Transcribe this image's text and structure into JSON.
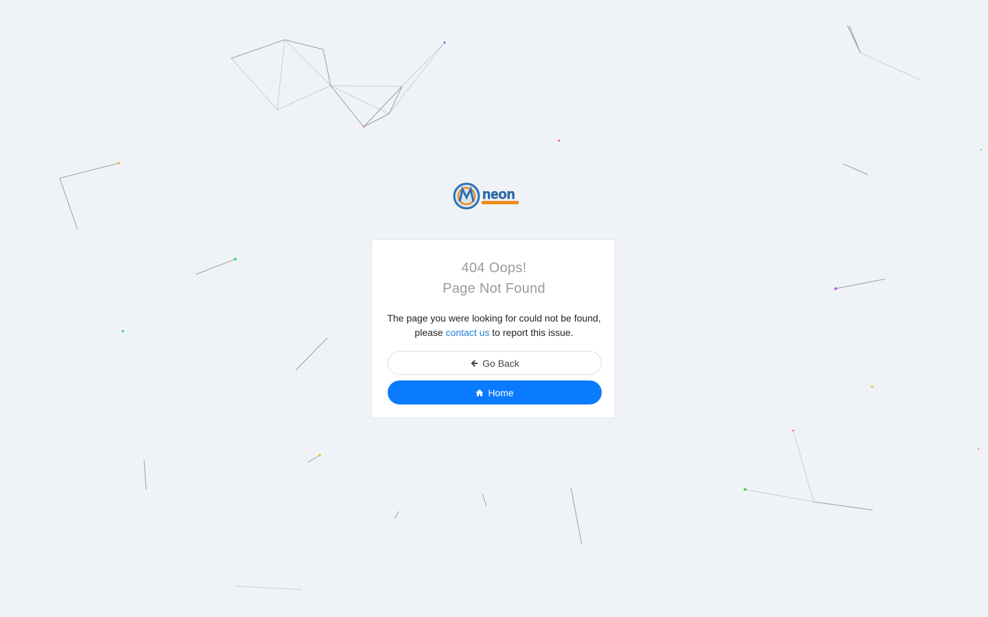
{
  "error": {
    "title_line1": "404 Oops!",
    "title_line2": "Page Not Found",
    "message_before": "The page you were looking for could not be found, please",
    "contact_link": "contact us",
    "message_after": "to report this issue."
  },
  "logo": {
    "text": "neon"
  },
  "buttons": {
    "back_label": "Go Back",
    "home_label": "Home"
  },
  "colors": {
    "background": "#eff3f7",
    "primary": "#0a7bff",
    "link": "#1a7fd4"
  },
  "icons": {
    "back": "arrow-left-icon",
    "home": "home-icon"
  }
}
